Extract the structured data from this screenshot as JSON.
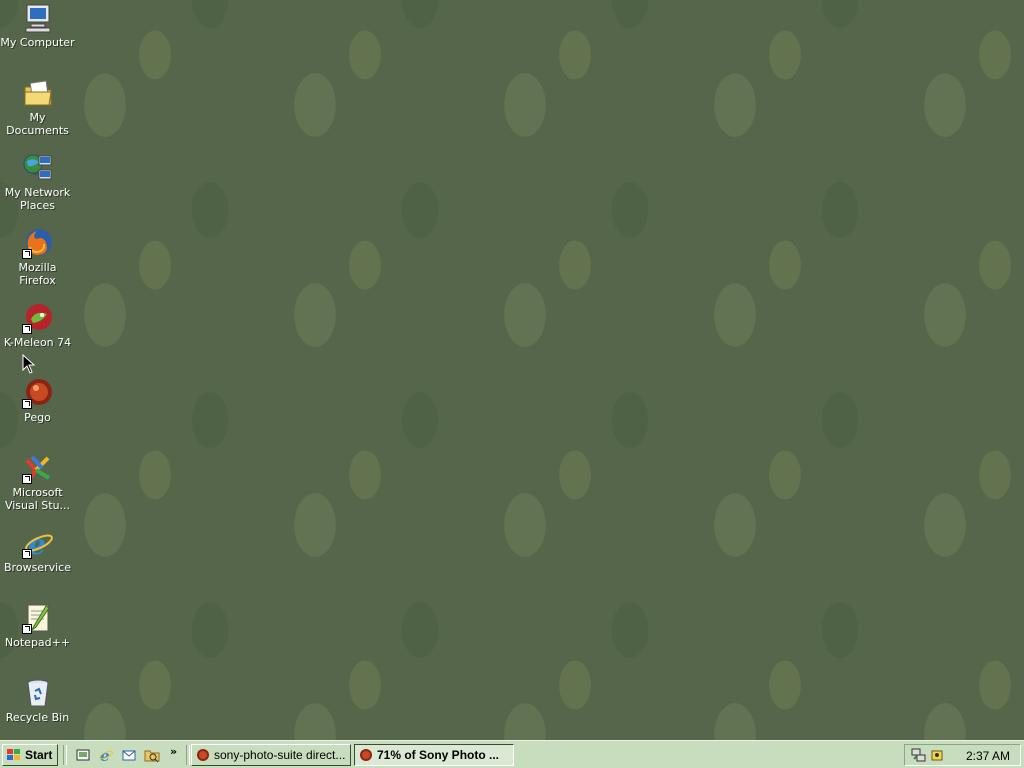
{
  "desktop": {
    "icons": [
      {
        "label": "My Computer",
        "icon": "computer-icon"
      },
      {
        "label": "My Documents",
        "icon": "folder-documents-icon"
      },
      {
        "label": "My Network",
        "label2": "Places",
        "icon": "network-places-icon"
      },
      {
        "label": "Mozilla Firefox",
        "icon": "firefox-icon"
      },
      {
        "label": "K-Meleon 74",
        "icon": "k-meleon-icon"
      },
      {
        "label": "Pego",
        "icon": "pego-icon"
      },
      {
        "label": "Microsoft",
        "label2": "Visual Stu...",
        "icon": "visual-studio-icon"
      },
      {
        "label": "Browservice",
        "icon": "internet-explorer-icon"
      },
      {
        "label": "Notepad++",
        "icon": "notepad-plus-plus-icon"
      },
      {
        "label": "Recycle Bin",
        "icon": "recycle-bin-icon"
      }
    ]
  },
  "taskbar": {
    "start_label": "Start",
    "quick_launch": [
      "show-desktop-icon",
      "internet-explorer-icon",
      "outlook-express-icon",
      "explorer-icon"
    ],
    "more_label": "»",
    "tasks": [
      {
        "label": "sony-photo-suite direct...",
        "active": false,
        "icon": "firefox-icon"
      },
      {
        "label": "71% of Sony Photo ...",
        "active": true,
        "icon": "download-icon"
      }
    ],
    "tray_icons": [
      "network-icon",
      "security-icon"
    ],
    "clock": "2:37 AM"
  },
  "colors": {
    "desktop": "#56664a",
    "taskbar": "#c8ddbd",
    "label_text": "#ffffff"
  }
}
